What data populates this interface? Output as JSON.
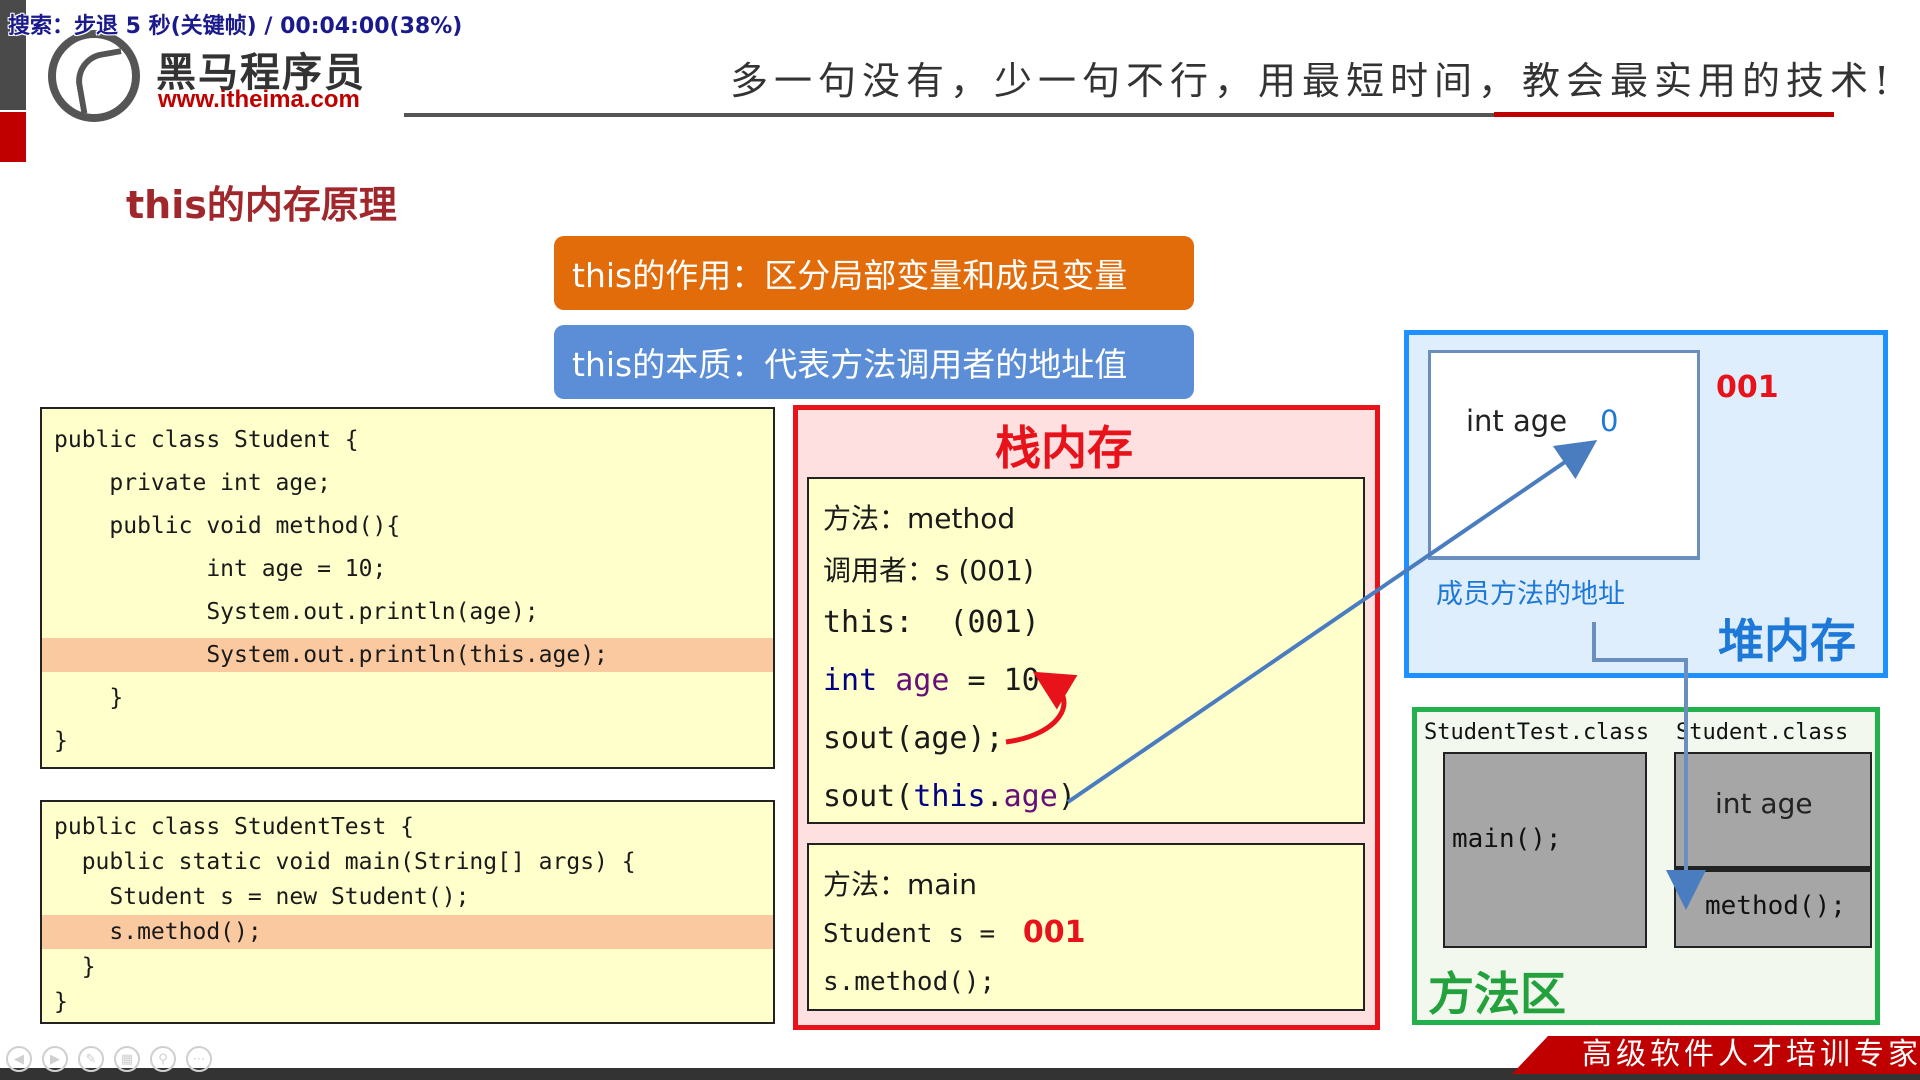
{
  "overlay": {
    "playback_text": "搜索：步退 5 秒(关键帧) / 00:04:00(38%)"
  },
  "header": {
    "logo_name": "黑马程序员",
    "logo_url": "www.itheima.com",
    "slogan": "多一句没有，少一句不行，用最短时间，教会最实用的技术!"
  },
  "slide": {
    "title": "this的内存原理",
    "banner_purpose": "this的作用：区分局部变量和成员变量",
    "banner_essence": "this的本质：代表方法调用者的地址值"
  },
  "code_student": {
    "lines": [
      "public class Student {",
      "    private int age;",
      "    public void method(){",
      "           int age = 10;",
      "           System.out.println(age);",
      "           System.out.println(this.age);",
      "    }",
      "}"
    ]
  },
  "code_test": {
    "lines": [
      "public class StudentTest {",
      "  public static void main(String[] args) {",
      "    Student s = new Student();",
      "    s.method();",
      "  }",
      "}"
    ]
  },
  "stack": {
    "title": "栈内存",
    "method_frame": {
      "method_label": "方法：method",
      "caller_label": "调用者：s (001)",
      "this_label": "this:  (001)",
      "local_var": "int age = 10",
      "sout_age": "sout(age);",
      "sout_this_age": "sout(this.age)"
    },
    "main_frame": {
      "method_label": "方法：main",
      "student_decl": "Student s = ",
      "student_addr": "001",
      "call": "s.method();"
    }
  },
  "heap": {
    "title": "堆内存",
    "address": "001",
    "field_label": "int age",
    "field_value": "0",
    "method_addr_label": "成员方法的地址"
  },
  "method_area": {
    "title": "方法区",
    "test_class_label": "StudentTest.class",
    "test_class_method": "main();",
    "student_class_label": "Student.class",
    "student_class_field": "int age",
    "student_class_method": "method();"
  },
  "footer": {
    "tagline": "高级软件人才培训专家"
  },
  "colors": {
    "stack_border": "#e8121b",
    "heap_border": "#1e90ff",
    "method_border": "#22b14c",
    "banner_orange": "#e26b0a",
    "banner_blue": "#5b8ed6",
    "title_red": "#a0282c"
  },
  "icons": [
    "prev-icon",
    "next-icon",
    "pen-icon",
    "grid-icon",
    "zoom-icon",
    "more-icon"
  ]
}
